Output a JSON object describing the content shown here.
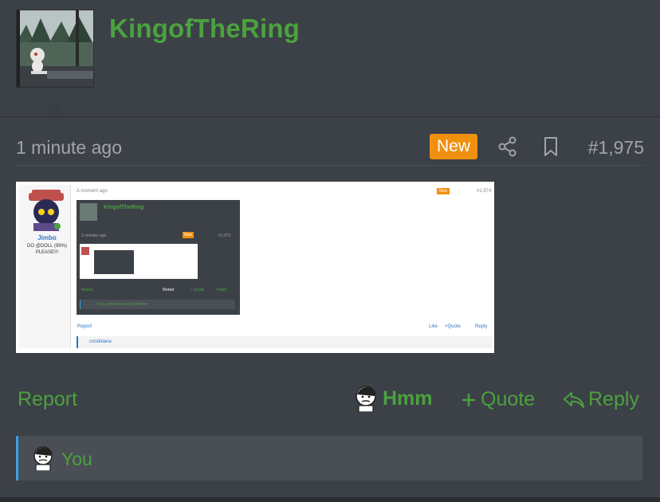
{
  "post": {
    "username": "KingofTheRing",
    "time": "1 minute ago",
    "badge": "New",
    "post_number": "#1,975"
  },
  "actions": {
    "report": "Report",
    "reaction": "Hmm",
    "quote": "Quote",
    "reply": "Reply"
  },
  "reactions": {
    "who": "You"
  },
  "embedded": {
    "time": "A moment ago",
    "badge": "New",
    "post_number": "#1,974",
    "author": "Jimbo",
    "author_title": "DO @DOLL (99%) PLEASE!!!",
    "inner": {
      "username": "KingofTheRing",
      "time": "2 minutes ago",
      "badge": "New",
      "post_number": "#1,973",
      "report": "Report",
      "reaction": "Noted",
      "quote": "+ Quote",
      "reply": "Reply",
      "reacted_by": "You, condolana and Stephen"
    },
    "report": "Report",
    "like": "Like",
    "quote": "+Quote",
    "reply": "Reply",
    "reacted_by": "condolana"
  },
  "colors": {
    "accent_green": "#4aa23e",
    "badge_orange": "#f0900f",
    "background": "#3c4047",
    "reaction_border": "#3aa0e8"
  }
}
